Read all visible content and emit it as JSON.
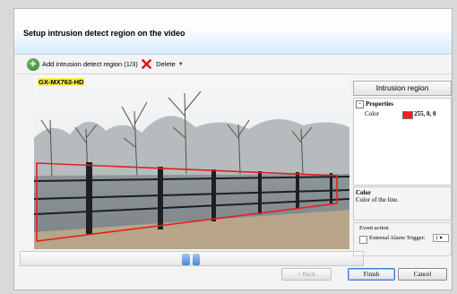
{
  "header": {
    "title": "Setup intrusion detect region on the video"
  },
  "toolbar": {
    "add_label": "Add intrusion detect region (1/3)",
    "delete_label": "Delete",
    "add_icon": "add-icon",
    "delete_icon": "delete-x-icon"
  },
  "video": {
    "camera_label": "GX-MX763-HD",
    "region_color": "#e02020"
  },
  "panel": {
    "title": "Intrusion region",
    "properties": {
      "section": "Properties",
      "key": "Color",
      "value": "255, 0, 0",
      "swatch_color": "#ee2020"
    },
    "description": {
      "heading": "Color",
      "text": "Color of the line."
    },
    "event": {
      "title": "Event action",
      "checkbox_label": "External Alarm Trigger:",
      "checked": false,
      "select_value": "1"
    }
  },
  "footer": {
    "back": "< Back",
    "finish": "Finish",
    "cancel": "Cancel"
  }
}
